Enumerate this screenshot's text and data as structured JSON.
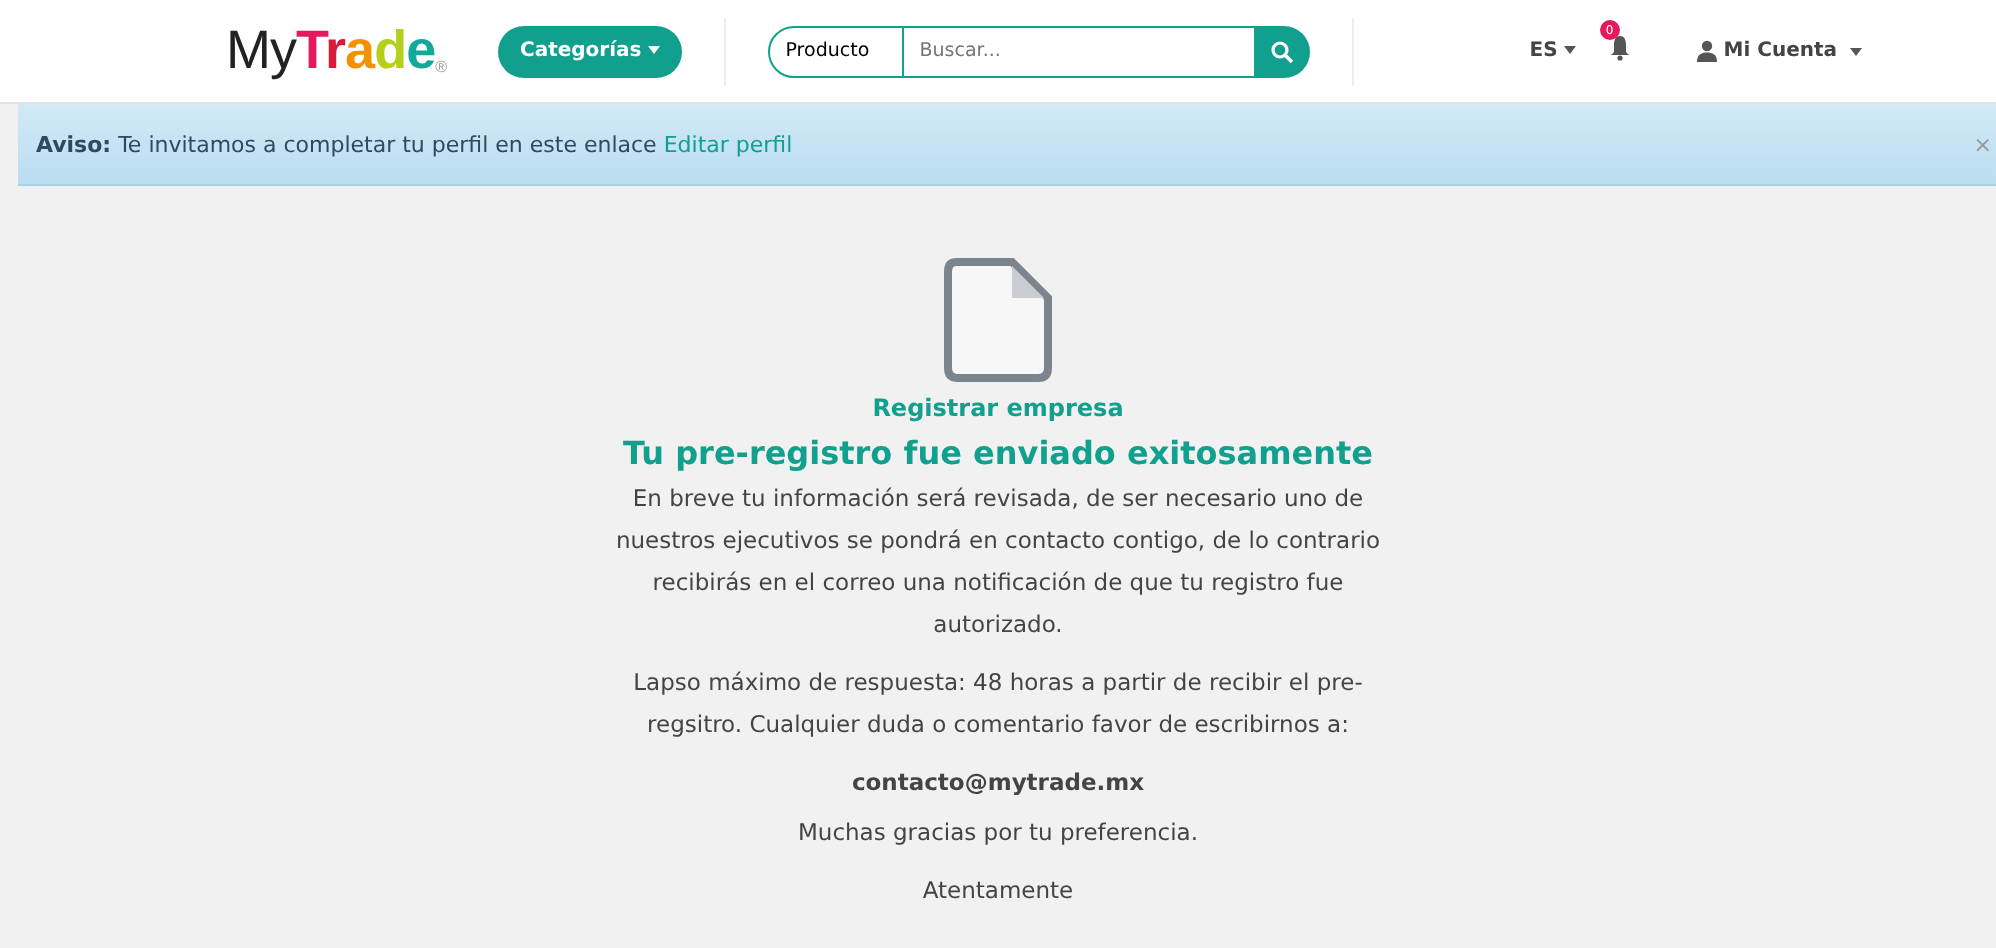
{
  "header": {
    "logo": [
      {
        "text": "My",
        "color": "#222222"
      },
      {
        "text": "T",
        "color": "#e6195f"
      },
      {
        "text": "r",
        "color": "#d81b3c"
      },
      {
        "text": "a",
        "color": "#f39200"
      },
      {
        "text": "d",
        "color": "#b5cf1a"
      },
      {
        "text": "e",
        "color": "#12a89a"
      }
    ],
    "logo_mark": "®",
    "categories_button": "Categorías",
    "search": {
      "scope": "Producto",
      "placeholder": "Buscar..."
    },
    "language": "ES",
    "notifications_count": "0",
    "account": "Mi Cuenta"
  },
  "notice": {
    "text": "**Aviso:** Te invitamos a completar tu perfil en este enlace",
    "link": "Editar perfil",
    "close": "×"
  },
  "content": {
    "section_label": "Registrar empresa",
    "title": "Tu pre-registro fue enviado exitosamente",
    "paragraphs": [
      {
        "text": "En breve tu información será revisada, de ser necesario uno de nuestros ejecutivos se pondrá en contacto contigo, de lo contrario recibirás en el correo una notificación de que tu registro fue autorizado.",
        "kind": "plain"
      },
      {
        "text": "Lapso máximo de respuesta: 48 horas a partir de recibir el pre-regsitro. Cualquier duda o comentario favor de escribirnos a:",
        "kind": "plain"
      },
      {
        "text": "contacto@mytrade.mx",
        "kind": "email"
      },
      {
        "text": "Muchas gracias por tu preferencia.",
        "kind": "plain"
      },
      {
        "text": "Atentamente",
        "kind": "plain"
      }
    ]
  }
}
